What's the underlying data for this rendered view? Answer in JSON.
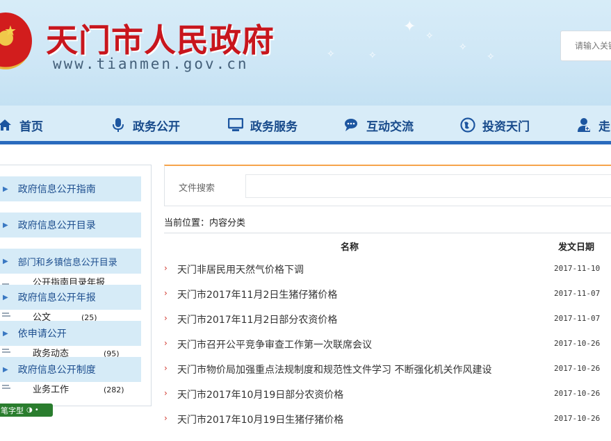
{
  "header": {
    "site_title": "天门市人民政府",
    "site_domain": "www.tianmen.gov.cn",
    "search_placeholder": "请输入关键"
  },
  "nav": {
    "items": [
      {
        "label": "首页",
        "icon": "home-icon"
      },
      {
        "label": "政务公开",
        "icon": "microphone-icon"
      },
      {
        "label": "政务服务",
        "icon": "monitor-icon"
      },
      {
        "label": "互动交流",
        "icon": "chat-icon"
      },
      {
        "label": "投资天门",
        "icon": "globe-icon"
      },
      {
        "label": "走",
        "icon": "medical-plus-icon"
      }
    ]
  },
  "sidebar": {
    "items": [
      {
        "label": "政府信息公开指南"
      },
      {
        "label": "政府信息公开目录"
      },
      {
        "label": "部门和乡镇信息公开目录"
      },
      {
        "label": "政府信息公开年报"
      },
      {
        "label": "依申请公开"
      },
      {
        "label": "政府信息公开制度"
      }
    ],
    "tree": [
      {
        "label": "公开指南目录年报",
        "count": ""
      },
      {
        "label": "公文",
        "count": "(25)"
      },
      {
        "label": "政务动态",
        "count": "(95)"
      },
      {
        "label": "业务工作",
        "count": "(282)"
      }
    ],
    "font_button": "笔字型"
  },
  "main": {
    "search_label": "文件搜索",
    "breadcrumb": "当前位置：内容分类",
    "columns": {
      "name": "名称",
      "date": "发文日期"
    },
    "rows": [
      {
        "title": "天门非居民用天然气价格下调",
        "date": "2017-11-10"
      },
      {
        "title": "天门市2017年11月2日生猪仔猪价格",
        "date": "2017-11-07"
      },
      {
        "title": "天门市2017年11月2日部分农资价格",
        "date": "2017-11-07"
      },
      {
        "title": "天门市召开公平竞争审查工作第一次联席会议",
        "date": "2017-10-26"
      },
      {
        "title": "天门市物价局加强重点法规制度和规范性文件学习 不断强化机关作风建设",
        "date": "2017-10-26"
      },
      {
        "title": "天门市2017年10月19日部分农资价格",
        "date": "2017-10-26"
      },
      {
        "title": "天门市2017年10月19日生猪仔猪价格",
        "date": "2017-10-26"
      }
    ]
  }
}
